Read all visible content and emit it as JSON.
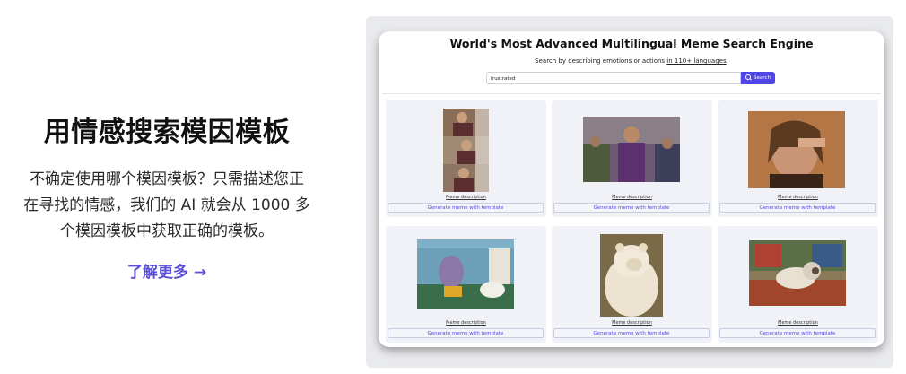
{
  "promo": {
    "title": "用情感搜索模因模板",
    "description_lines": [
      "不确定使用哪个模因模板？只需描述您正",
      "在寻找的情感，我们的 AI 就会从 1000 多",
      "个模因模板中获取正确的模板。"
    ],
    "link": "了解更多 →"
  },
  "app": {
    "title": "World's Most Advanced Multilingual Meme Search Engine",
    "subtitle_prefix": "Search by describing emotions or actions ",
    "subtitle_link": "in 110+ languages",
    "subtitle_suffix": ".",
    "search_value": "frustrated",
    "search_button": "Search",
    "cards": [
      {
        "description": "Meme description",
        "button": "Generate meme with template"
      },
      {
        "description": "Meme description",
        "button": "Generate meme with template"
      },
      {
        "description": "Meme description",
        "button": "Generate meme with template"
      },
      {
        "description": "Meme description",
        "button": "Generate meme with template"
      },
      {
        "description": "Meme description",
        "button": "Generate meme with template"
      },
      {
        "description": "Meme description",
        "button": "Generate meme with template"
      }
    ]
  },
  "colors": {
    "accent": "#4f46e5",
    "link": "#5b4fd8",
    "card_bg": "#f1f2f8"
  },
  "icons": [
    "search-icon",
    "arrow-right-icon"
  ]
}
